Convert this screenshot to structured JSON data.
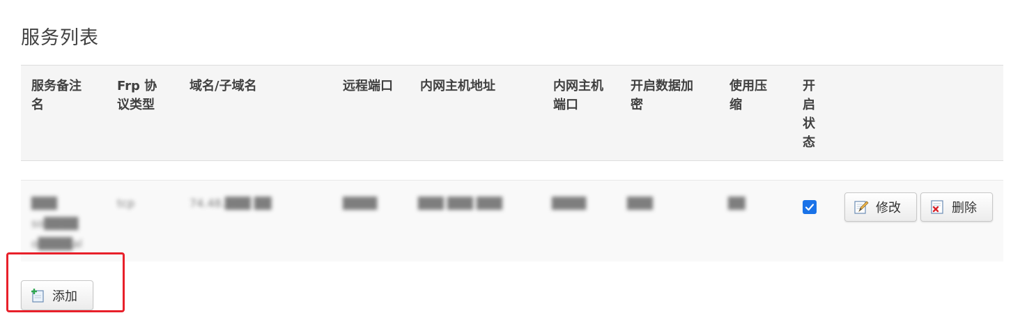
{
  "page": {
    "title": "服务列表"
  },
  "table": {
    "headers": {
      "remark": "服务备注\n名",
      "protocol": "Frp 协\n议类型",
      "domain": "域名/子域名",
      "remote_port": "远程端口",
      "local_host": "内网主机地址",
      "local_port": "内网主机\n端口",
      "encryption": "开启数据加\n密",
      "compression": "使用压\n缩",
      "enabled": "开\n启\n状\n态"
    },
    "rows": [
      {
        "remark": "███\nso████\no████al",
        "protocol": "tcp",
        "domain": "74.48.███ ██",
        "remote_port": "████",
        "local_host": "███ ███ ███",
        "local_port": "████",
        "encryption": "███",
        "compression": "██",
        "enabled": true,
        "edit_label": "修改",
        "delete_label": "删除"
      }
    ]
  },
  "actions": {
    "add_label": "添加"
  },
  "colors": {
    "header_bg": "#f5f5f5",
    "row_bg": "#f9f9f9",
    "checkbox": "#1a73e8",
    "highlight": "#e8202a"
  }
}
